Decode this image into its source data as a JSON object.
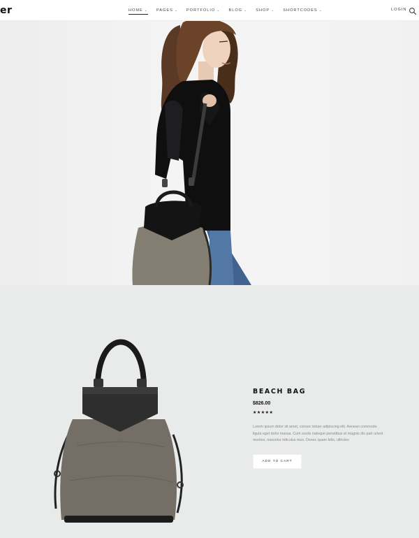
{
  "header": {
    "logo_text": "er",
    "nav": [
      {
        "label": "HOME",
        "active": true
      },
      {
        "label": "PAGES"
      },
      {
        "label": "PORTFOLIO"
      },
      {
        "label": "BLOG"
      },
      {
        "label": "SHOP"
      },
      {
        "label": "SHORTCODES"
      }
    ],
    "chevron": "⌄",
    "login_label": "LOGIN",
    "search_icon": "search-icon"
  },
  "product": {
    "title": "BEACH BAG",
    "price": "$826.00",
    "stars": "★★★★★",
    "description": "Lorem ipsum dolor sit amet, consec tetuer adipiscing elit. Aenean commodo ligula eget dolor massa. Cum sociis natoque penatibus et magnis dis part urient montes, nascetur ridiculus mus. Donec quam felis, ultricies",
    "cart_label": "ADD TO CART"
  }
}
